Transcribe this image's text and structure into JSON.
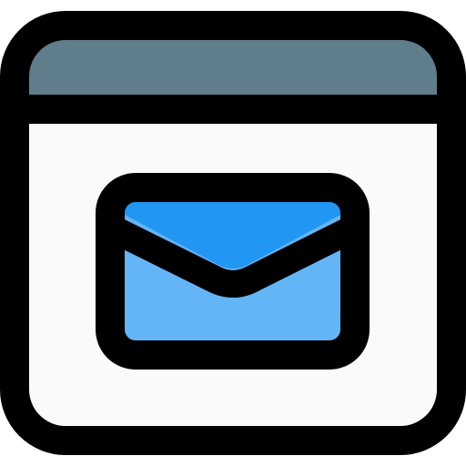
{
  "icon": {
    "name": "browser-mail-icon",
    "colors": {
      "outline": "#000000",
      "titlebar": "#607D8B",
      "window_body": "#FAFAFA",
      "envelope_flap": "#2196F3",
      "envelope_body": "#64B5F6"
    }
  }
}
